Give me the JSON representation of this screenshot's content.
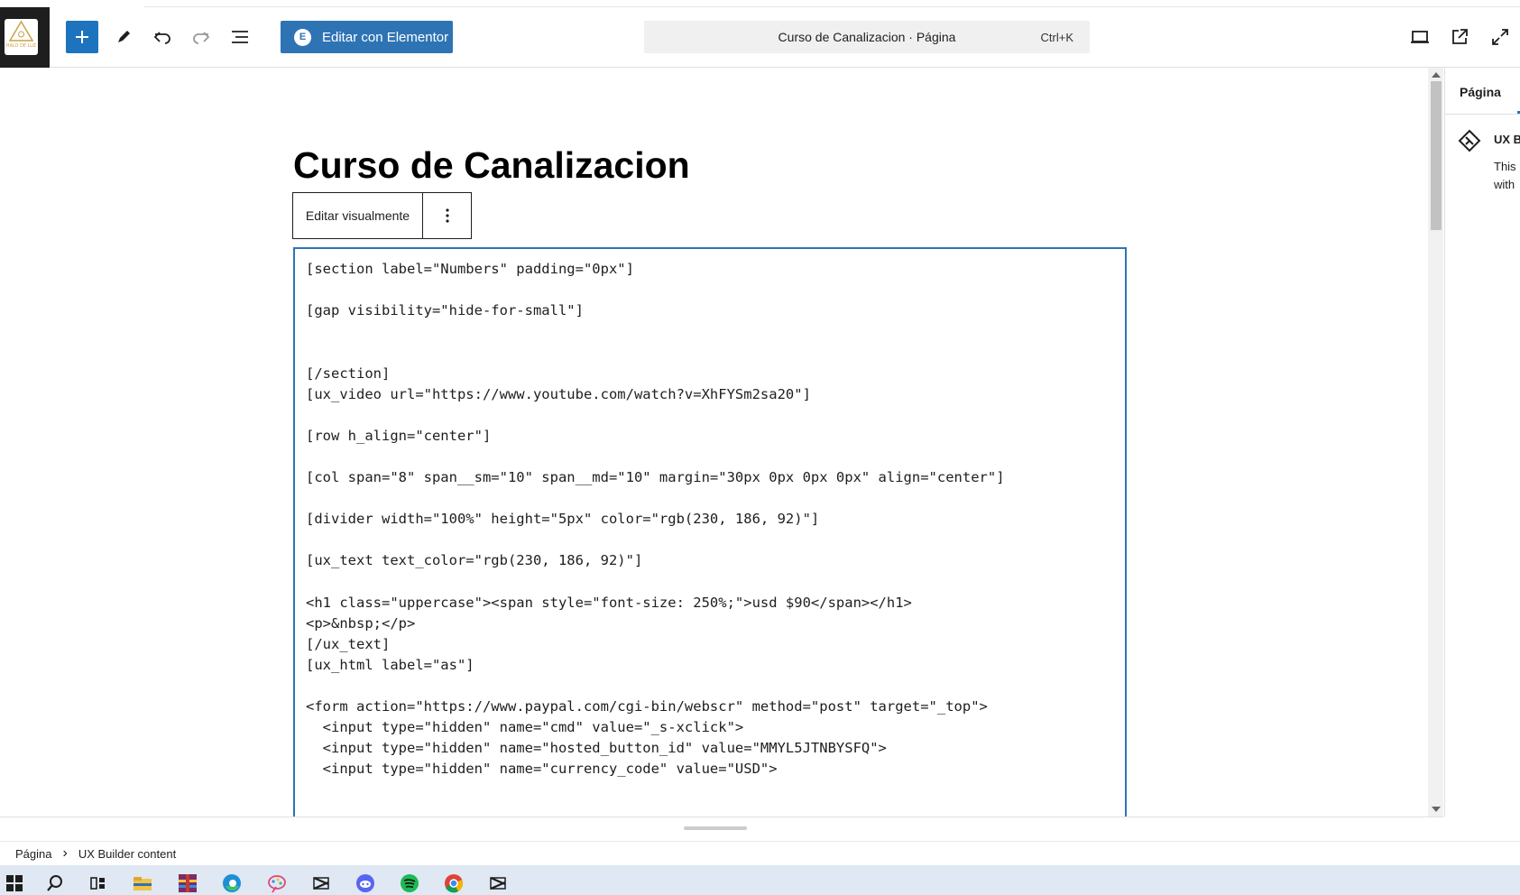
{
  "toolbar": {
    "site_logo_text": "HALO DE LUZ",
    "add_block_label": "Agregar bloque",
    "elementor_button_label": "Editar con Elementor",
    "command_title": "Curso de Canalizacion · Página",
    "command_shortcut": "Ctrl+K"
  },
  "editor": {
    "post_title": "Curso de Canalizacion",
    "block_toolbar": {
      "edit_visually_label": "Editar visualmente"
    },
    "code_lines": [
      "[section label=\"Numbers\" padding=\"0px\"]",
      "",
      "[gap visibility=\"hide-for-small\"]",
      "",
      "",
      "[/section]",
      "[ux_video url=\"https://www.youtube.com/watch?v=XhFYSm2sa20\"]",
      "",
      "[row h_align=\"center\"]",
      "",
      "[col span=\"8\" span__sm=\"10\" span__md=\"10\" margin=\"30px 0px 0px 0px\" align=\"center\"]",
      "",
      "[divider width=\"100%\" height=\"5px\" color=\"rgb(230, 186, 92)\"]",
      "",
      "[ux_text text_color=\"rgb(230, 186, 92)\"]",
      "",
      "<h1 class=\"uppercase\"><span style=\"font-size: 250%;\">usd $90</span></h1>",
      "<p>&nbsp;</p>",
      "[/ux_text]",
      "[ux_html label=\"as\"]",
      "",
      "<form action=\"https://www.paypal.com/cgi-bin/webscr\" method=\"post\" target=\"_top\">",
      "  <input type=\"hidden\" name=\"cmd\" value=\"_s-xclick\">",
      "  <input type=\"hidden\" name=\"hosted_button_id\" value=\"MMYL5JTNBYSFQ\">",
      "  <input type=\"hidden\" name=\"currency_code\" value=\"USD\">"
    ]
  },
  "sidebar": {
    "tab_label": "Página",
    "ux_title": "UX B",
    "ux_desc_line1": "This",
    "ux_desc_line2": "with"
  },
  "footer": {
    "breadcrumb_root": "Página",
    "breadcrumb_separator": "›",
    "breadcrumb_current": "UX Builder content"
  },
  "colors": {
    "accent": "#2e74b5",
    "add_button": "#1e73be",
    "logo_bg": "#1e1e1e",
    "taskbar_bg": "#dfe8f3"
  },
  "taskbar_icons": [
    "windows-start-icon",
    "search-icon",
    "task-view-icon",
    "file-explorer-icon",
    "winrar-icon",
    "edge-icon",
    "paint-icon",
    "capcut-icon",
    "discord-icon",
    "spotify-icon",
    "chrome-icon",
    "capcut-icon"
  ]
}
